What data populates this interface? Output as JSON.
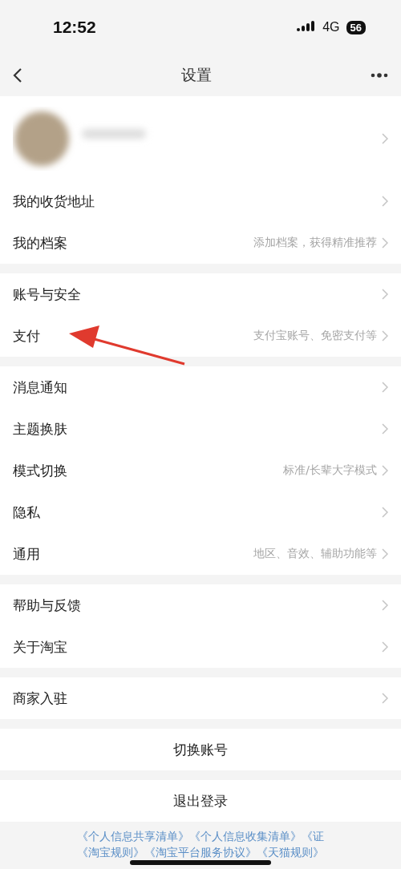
{
  "status_bar": {
    "time": "12:52",
    "network": "4G",
    "battery": "56"
  },
  "nav": {
    "title": "设置"
  },
  "profile": {
    "kind": "profile"
  },
  "sections": [
    {
      "rows": [
        {
          "label": "我的收货地址"
        },
        {
          "label": "我的档案",
          "hint": "添加档案，获得精准推荐"
        }
      ]
    },
    {
      "rows": [
        {
          "label": "账号与安全"
        },
        {
          "label": "支付",
          "hint": "支付宝账号、免密支付等"
        }
      ]
    },
    {
      "rows": [
        {
          "label": "消息通知"
        },
        {
          "label": "主题换肤"
        },
        {
          "label": "模式切换",
          "hint": "标准/长辈大字模式"
        },
        {
          "label": "隐私"
        },
        {
          "label": "通用",
          "hint": "地区、音效、辅助功能等"
        }
      ]
    },
    {
      "rows": [
        {
          "label": "帮助与反馈"
        },
        {
          "label": "关于淘宝"
        }
      ]
    },
    {
      "rows": [
        {
          "label": "商家入驻"
        }
      ]
    }
  ],
  "actions": [
    "切换账号",
    "退出登录"
  ],
  "footer_links": [
    [
      "《个人信息共享清单》",
      "《个人信息收集清单》",
      "《证"
    ],
    [
      "《淘宝规则》",
      "《淘宝平台服务协议》",
      "《天猫规则》"
    ]
  ]
}
